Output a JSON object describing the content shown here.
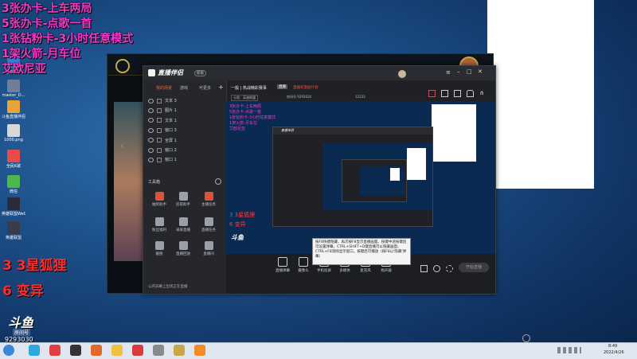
{
  "overlay": {
    "line1": "3张办卡-上车两局",
    "line2": "5张办卡-点歌一首",
    "line3": "1张钻粉卡-3小时任意模式",
    "line4": "1架火箭-月车位",
    "line5": "艾欧尼亚",
    "mid1": "3 3星狐狸",
    "mid2": "6 变异"
  },
  "desktop_icons": [
    {
      "label": "游戏助手",
      "color": "#3b7bd8"
    },
    {
      "label": "master_D...",
      "color": "#6e7f96"
    },
    {
      "label": "斗鱼直播伴侣",
      "color": "#e8a33b"
    },
    {
      "label": "1000.png",
      "color": "#d8d8d8"
    },
    {
      "label": "全民K歌",
      "color": "#e94b4b"
    },
    {
      "label": "微信",
      "color": "#4cb84c"
    },
    {
      "label": "英雄联盟WeGame版",
      "color": "#2a2a3a"
    },
    {
      "label": "英雄联盟",
      "color": "#3a3a4a"
    }
  ],
  "douyu": {
    "logo": "斗鱼",
    "sub": "房间号",
    "room": "9293030"
  },
  "studio": {
    "app_name": "直播伴侣",
    "tag": "新版",
    "tabs": [
      "我的场景",
      "游戏",
      "可更多"
    ],
    "header_title": "一般 | 热战精彩赛事",
    "header_tag": "直播",
    "header_red": "直播有激励计划",
    "header_sub1": "分类：英雄联盟",
    "header_sub2": "房间号 9293030",
    "header_count": "12233",
    "layers": [
      "文本 3",
      "图片 1",
      "文本 1",
      "窗口 3",
      "全屏 1",
      "窗口 2",
      "窗口 1"
    ],
    "toolbox_label": "工具箱",
    "tools": [
      {
        "label": "抽奖助手",
        "color": "#e0503a"
      },
      {
        "label": "房管助手",
        "color": "#9aa0aa"
      },
      {
        "label": "主播任务",
        "color": "#e0503a"
      },
      {
        "label": "粉丝福利",
        "color": "#9aa0aa"
      },
      {
        "label": "录屏直播",
        "color": "#9aa0aa"
      },
      {
        "label": "直播任务",
        "color": "#9aa0aa"
      },
      {
        "label": "截图",
        "color": "#9aa0aa"
      },
      {
        "label": "直播回放",
        "color": "#9aa0aa"
      },
      {
        "label": "直播间",
        "color": "#9aa0aa"
      }
    ],
    "bottom_tools": [
      "直播弹幕",
      "摄像头",
      "手机投屏",
      "多媒体",
      "麦克风",
      "扬声器"
    ],
    "start_button": "开始直播",
    "footer_hint": "公开屏幕上出现正在直播",
    "tooltip": "按F8快捷隐藏，再次按F8显示直播画面。按键中途按键后可设置弹幕，CTRL+SHIFT+D键直播可以隐藏画面；CTRL+F8消除显示窗口。按键后可播放（按F8以'隐藏'弹幕）",
    "nested_pink": [
      "3张办卡-上车两局",
      "5张办卡-点歌一首",
      "1张钻粉卡-3小时任意模式",
      "1架火箭-月车位",
      "艾欧尼亚"
    ],
    "nested_mid": [
      "3 3星狐狸",
      "6 变异"
    ],
    "nested_logo": "斗鱼"
  },
  "taskbar": {
    "time": "8:49",
    "date": "2022/4/26",
    "icons": [
      {
        "name": "start",
        "color": "#3b86d8"
      },
      {
        "name": "browser",
        "color": "#2fa8e0"
      },
      {
        "name": "music",
        "color": "#e04040"
      },
      {
        "name": "game",
        "color": "#333"
      },
      {
        "name": "store",
        "color": "#e06a2a"
      },
      {
        "name": "video",
        "color": "#f0c040"
      },
      {
        "name": "netease",
        "color": "#d93a3a"
      },
      {
        "name": "app",
        "color": "#8a8a8a"
      },
      {
        "name": "lol",
        "color": "#c8a94a"
      },
      {
        "name": "douyu",
        "color": "#f28a2a"
      }
    ]
  }
}
